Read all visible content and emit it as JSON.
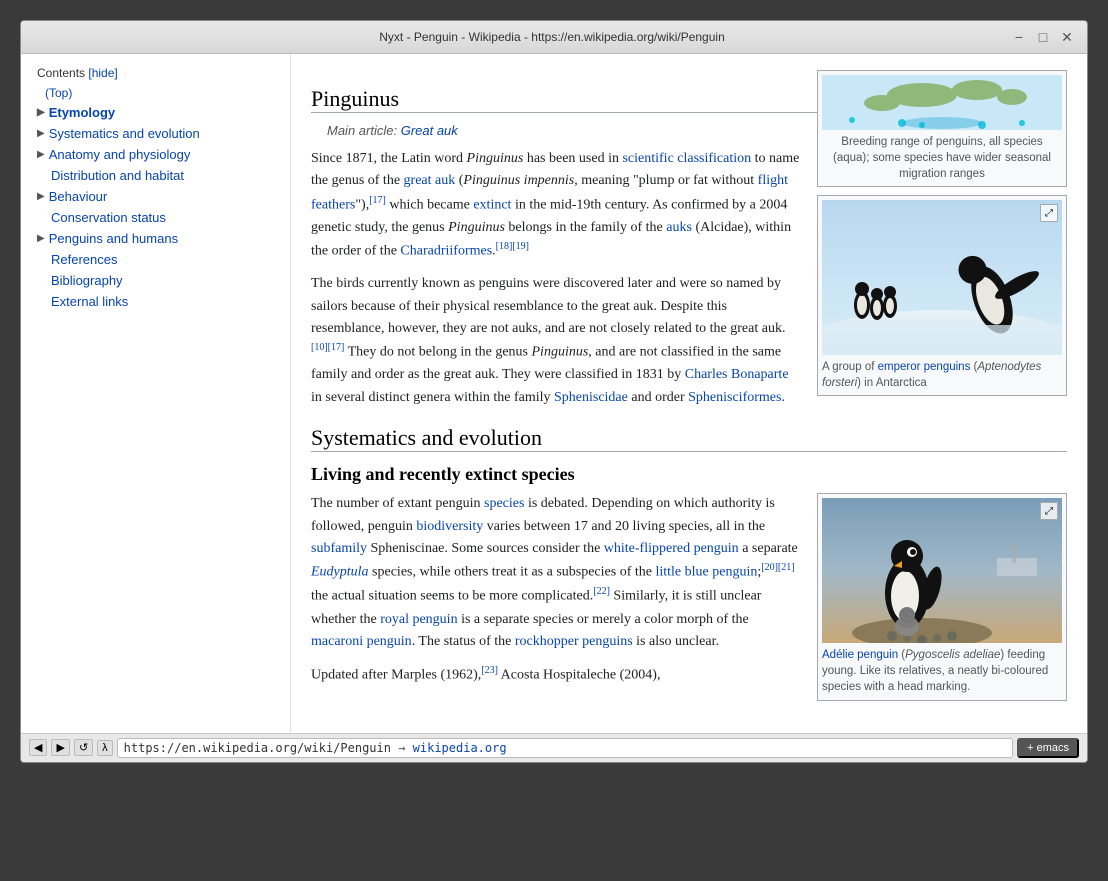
{
  "window": {
    "title": "Nyxt - Penguin - Wikipedia - https://en.wikipedia.org/wiki/Penguin",
    "titlebar_controls": [
      "−",
      "□",
      "✕"
    ]
  },
  "statusbar": {
    "nav_buttons": [
      "◀",
      "▶",
      "↺",
      "λ"
    ],
    "url": "https://en.wikipedia.org/wiki/Penguin",
    "url_display": "https://en.wikipedia.org/wiki/Penguin → wikipedia.org",
    "emacs_label": "+ emacs"
  },
  "sidebar": {
    "contents_label": "Contents",
    "hide_label": "[hide]",
    "top_label": "(Top)",
    "items": [
      {
        "id": "etymology",
        "label": "Etymology",
        "has_arrow": true,
        "bold": true
      },
      {
        "id": "systematics",
        "label": "Systematics and evolution",
        "has_arrow": true
      },
      {
        "id": "anatomy",
        "label": "Anatomy and physiology",
        "has_arrow": true
      },
      {
        "id": "distribution",
        "label": "Distribution and habitat"
      },
      {
        "id": "behaviour",
        "label": "Behaviour",
        "has_arrow": true
      },
      {
        "id": "conservation",
        "label": "Conservation status"
      },
      {
        "id": "penguins-humans",
        "label": "Penguins and humans",
        "has_arrow": true
      },
      {
        "id": "references",
        "label": "References"
      },
      {
        "id": "bibliography",
        "label": "Bibliography"
      },
      {
        "id": "external",
        "label": "External links"
      }
    ]
  },
  "main": {
    "sections": [
      {
        "id": "pinguinus",
        "heading": "Pinguinus",
        "main_article_label": "Main article:",
        "main_article_link": "Great auk",
        "paragraphs": [
          "Since 1871, the Latin word Pinguinus has been used in scientific classification to name the genus of the great auk (Pinguinus impennis, meaning \"plump or fat without flight feathers\"),[17] which became extinct in the mid-19th century. As confirmed by a 2004 genetic study, the genus Pinguinus belongs in the family of the auks (Alcidae), within the order of the Charadriiformes.[18][19]",
          "The birds currently known as penguins were discovered later and were so named by sailors because of their physical resemblance to the great auk. Despite this resemblance, however, they are not auks, and are not closely related to the great auk.[10][17] They do not belong in the genus Pinguinus, and are not classified in the same family and order as the great auk. They were classified in 1831 by Charles Bonaparte in several distinct genera within the family Spheniscidae and order Sphenisciformes."
        ]
      },
      {
        "id": "systematics",
        "heading": "Systematics and evolution",
        "subsections": [
          {
            "id": "living-species",
            "heading": "Living and recently extinct species",
            "paragraphs": [
              "The number of extant penguin species is debated. Depending on which authority is followed, penguin biodiversity varies between 17 and 20 living species, all in the subfamily Spheniscinae. Some sources consider the white-flippered penguin a separate Eudyptula species, while others treat it as a subspecies of the little blue penguin;[20][21] the actual situation seems to be more complicated.[22] Similarly, it is still unclear whether the royal penguin is a separate species or merely a color morph of the macaroni penguin. The status of the rockhopper penguins is also unclear.",
              "Updated after Marples (1962),[23] Acosta Hospitaleche (2004),"
            ]
          }
        ]
      }
    ],
    "images": [
      {
        "id": "map",
        "caption": "Breeding range of penguins, all species (aqua); some species have wider seasonal migration ranges"
      },
      {
        "id": "emperor-penguins",
        "caption": "A group of emperor penguins (Aptenodytes forsteri) in Antarctica"
      },
      {
        "id": "adelie-penguin",
        "caption": "Adélie penguin (Pygoscelis adeliae) feeding young. Like its relatives, a neatly bi-coloured species with a head marking."
      }
    ],
    "links": {
      "scientific_classification": "scientific classification",
      "great_auk": "great auk",
      "flight_feathers": "flight feathers",
      "extinct": "extinct",
      "auks": "auks",
      "charadriiformes": "Charadriiformes",
      "charles": "Charles",
      "bonaparte": "Bonaparte",
      "spheniscidae": "Spheniscidae",
      "sphenisciformes": "Sphenisciformes",
      "species": "species",
      "biodiversity": "biodiversity",
      "subfamily": "subfamily",
      "white_flippered": "white-flippered penguin",
      "eudyptula": "Eudyptula",
      "little_blue": "little blue penguin",
      "royal_penguin": "royal penguin",
      "macaroni_penguin": "macaroni penguin",
      "rockhopper": "rockhopper penguins",
      "emperor_penguins": "emperor penguins"
    }
  }
}
